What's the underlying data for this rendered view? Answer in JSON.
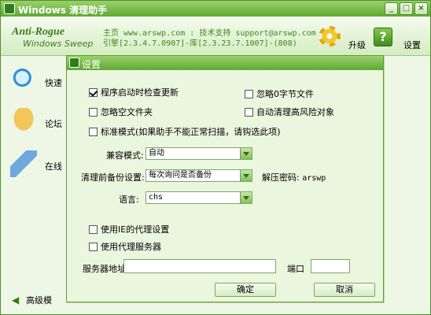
{
  "main_window": {
    "title": "Windows 清理助手",
    "controls": {
      "minimize": "_",
      "maximize": "□",
      "close": "×"
    },
    "logo": {
      "line1": "Anti-Rogue",
      "line2": "Windows Sweep"
    },
    "info": {
      "line1": "主页 www.arswp.com : 技术支持 support@arswp.com",
      "line2": "引擎[2.3.4.7.0907]-库[2.3.23.7.1007]-(808)"
    },
    "toolbar": {
      "upgrade": "升级",
      "settings": "设置"
    },
    "sidebar": {
      "items": [
        "快速",
        "论坛",
        "在线"
      ],
      "advanced": "高级模"
    }
  },
  "dialog": {
    "title": "设置",
    "options": {
      "check_update": {
        "label": "程序启动时检查更新",
        "checked": true
      },
      "ignore_zero_byte": {
        "label": "忽略0字节文件",
        "checked": false
      },
      "ignore_empty_folder": {
        "label": "忽略空文件夹",
        "checked": false
      },
      "auto_clean_high_risk": {
        "label": "自动清理高风险对象",
        "checked": false
      },
      "standard_mode": {
        "label": "标准模式(如果助手不能正常扫描，请钩选此项)",
        "checked": false
      }
    },
    "compat_mode": {
      "label": "兼容模式:",
      "value": "自动"
    },
    "backup_setting": {
      "label": "清理前备份设置:",
      "value": "每次询问是否备份"
    },
    "unzip_password": {
      "label": "解压密码:",
      "value": "arswp"
    },
    "language": {
      "label": "语言:",
      "value": "chs"
    },
    "proxy": {
      "use_ie_proxy": {
        "label": "使用IE的代理设置",
        "checked": false
      },
      "use_proxy_server": {
        "label": "使用代理服务器",
        "checked": false
      },
      "server_label": "服务器地址",
      "server_value": "",
      "port_label": "端口",
      "port_value": ""
    },
    "buttons": {
      "ok": "确定",
      "cancel": "取消"
    }
  }
}
